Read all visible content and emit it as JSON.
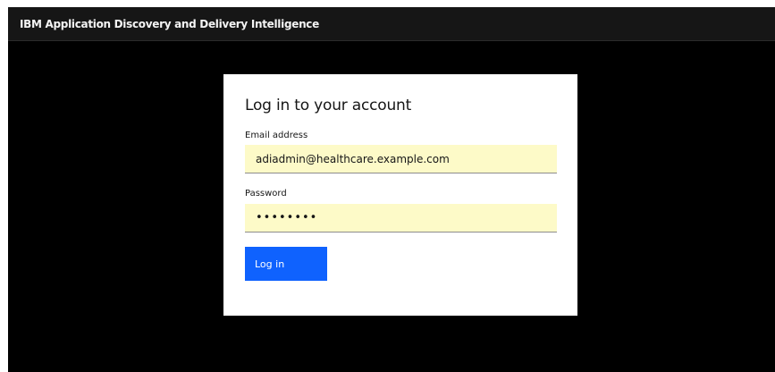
{
  "header": {
    "title": "IBM Application Discovery and Delivery Intelligence"
  },
  "login": {
    "heading": "Log in to your account",
    "email_label": "Email address",
    "email_value": "adiadmin@healthcare.example.com",
    "password_label": "Password",
    "password_value": "••••••••",
    "submit_label": "Log in"
  },
  "colors": {
    "header_bg": "#161616",
    "page_bg": "#000000",
    "field_bg": "#fdfac8",
    "primary_button": "#0f62fe"
  }
}
